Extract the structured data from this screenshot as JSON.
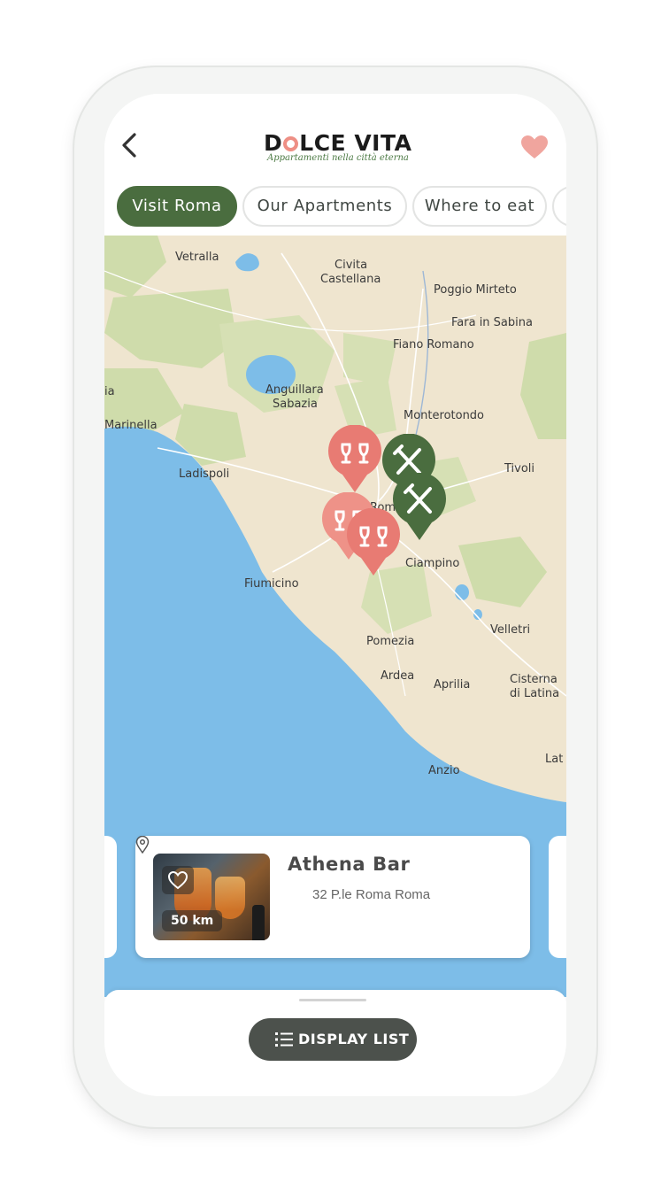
{
  "app": {
    "logo_title_start": "D",
    "logo_title_end": "LCE VITA",
    "logo_subtitle": "Appartamenti nella città eterna"
  },
  "header": {
    "back_icon": "chevron-left-icon",
    "favorite_icon": "heart-icon"
  },
  "tabs": [
    {
      "label": "Visit Roma",
      "active": true
    },
    {
      "label": "Our Apartments",
      "active": false
    },
    {
      "label": "Where to eat",
      "active": false
    }
  ],
  "map": {
    "places": {
      "vetralla": "Vetralla",
      "civita": "Civita",
      "castellana": "Castellana",
      "poggio_mirteto": "Poggio Mirteto",
      "fara": "Fara in Sabina",
      "fiano": "Fiano Romano",
      "anguillara": "Anguillara",
      "sabazia": "Sabazia",
      "ia": "ia",
      "monterotondo": "Monterotondo",
      "marinella": "Marinella",
      "ladispoli": "Ladispoli",
      "tivoli": "Tivoli",
      "roma": "Roma",
      "ciampino": "Ciampino",
      "fiumicino": "Fiumicino",
      "velletri": "Velletri",
      "pomezia": "Pomezia",
      "ardea": "Ardea",
      "aprilia": "Aprilia",
      "cisterna": "Cisterna",
      "di_latina": "di Latina",
      "lat": "Lat",
      "anzio": "Anzio"
    },
    "pins": [
      {
        "type": "bar",
        "icon": "wine-glasses-icon",
        "color": "#e87b73"
      },
      {
        "type": "restaurant",
        "icon": "fork-knife-icon",
        "color": "#4a6d3f"
      },
      {
        "type": "restaurant",
        "icon": "fork-knife-icon",
        "color": "#4a6d3f"
      },
      {
        "type": "bar",
        "icon": "wine-glasses-icon",
        "color": "#e87b73"
      },
      {
        "type": "bar",
        "icon": "wine-glasses-icon",
        "color": "#e87b73"
      }
    ]
  },
  "card": {
    "title": "Athena Bar",
    "address": "32 P.le Roma Roma",
    "distance": "50 km",
    "fav_icon": "heart-outline-icon",
    "address_icon": "location-pin-icon"
  },
  "sheet": {
    "button_label": "DISPLAY LIST",
    "button_icon": "list-icon"
  },
  "colors": {
    "brand_green": "#4a6d3f",
    "brand_pink": "#e87b73",
    "water": "#7dbde8",
    "land": "#efe5cf",
    "button_dark": "#4c514c"
  }
}
